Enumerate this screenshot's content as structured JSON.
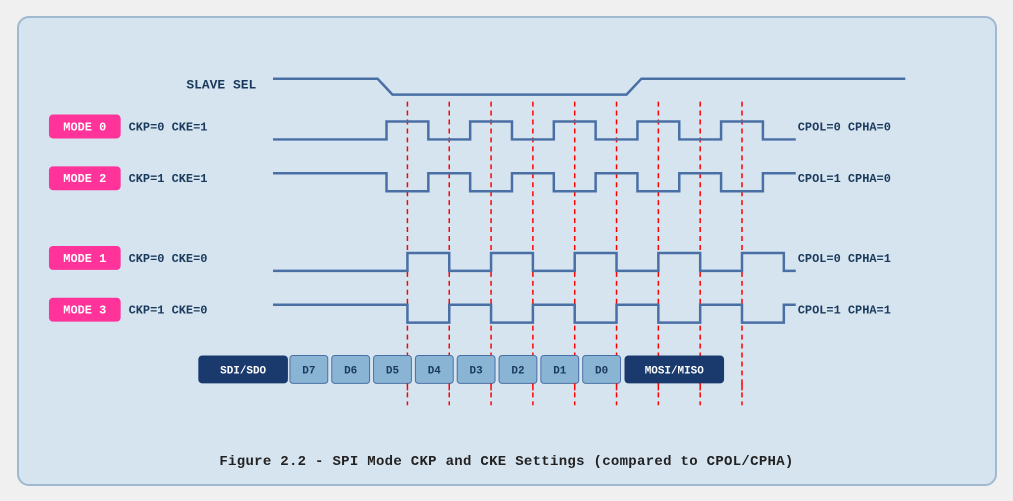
{
  "title": "Figure 2.2 - SPI Mode CKP and CKE Settings (compared to CPOL/CPHA)",
  "diagram": {
    "slave_sel_label": "SLAVE SEL",
    "modes": [
      {
        "label": "MODE 0",
        "params": "CKP=0  CKE=1",
        "right": "CPOL=0  CPHA=0"
      },
      {
        "label": "MODE 2",
        "params": "CKP=1  CKE=1",
        "right": "CPOL=1  CPHA=0"
      },
      {
        "label": "MODE 1",
        "params": "CKP=0  CKE=0",
        "right": "CPOL=0  CPHA=1"
      },
      {
        "label": "MODE 3",
        "params": "CKP=1  CKE=0",
        "right": "CPOL=1  CPHA=1"
      }
    ],
    "data_labels": [
      "SDI/SDO",
      "D7",
      "D6",
      "D5",
      "D4",
      "D3",
      "D2",
      "D1",
      "D0",
      "MOSI/MISO"
    ]
  },
  "caption": "Figure 2.2 - SPI Mode CKP and CKE Settings (compared to CPOL/CPHA)"
}
